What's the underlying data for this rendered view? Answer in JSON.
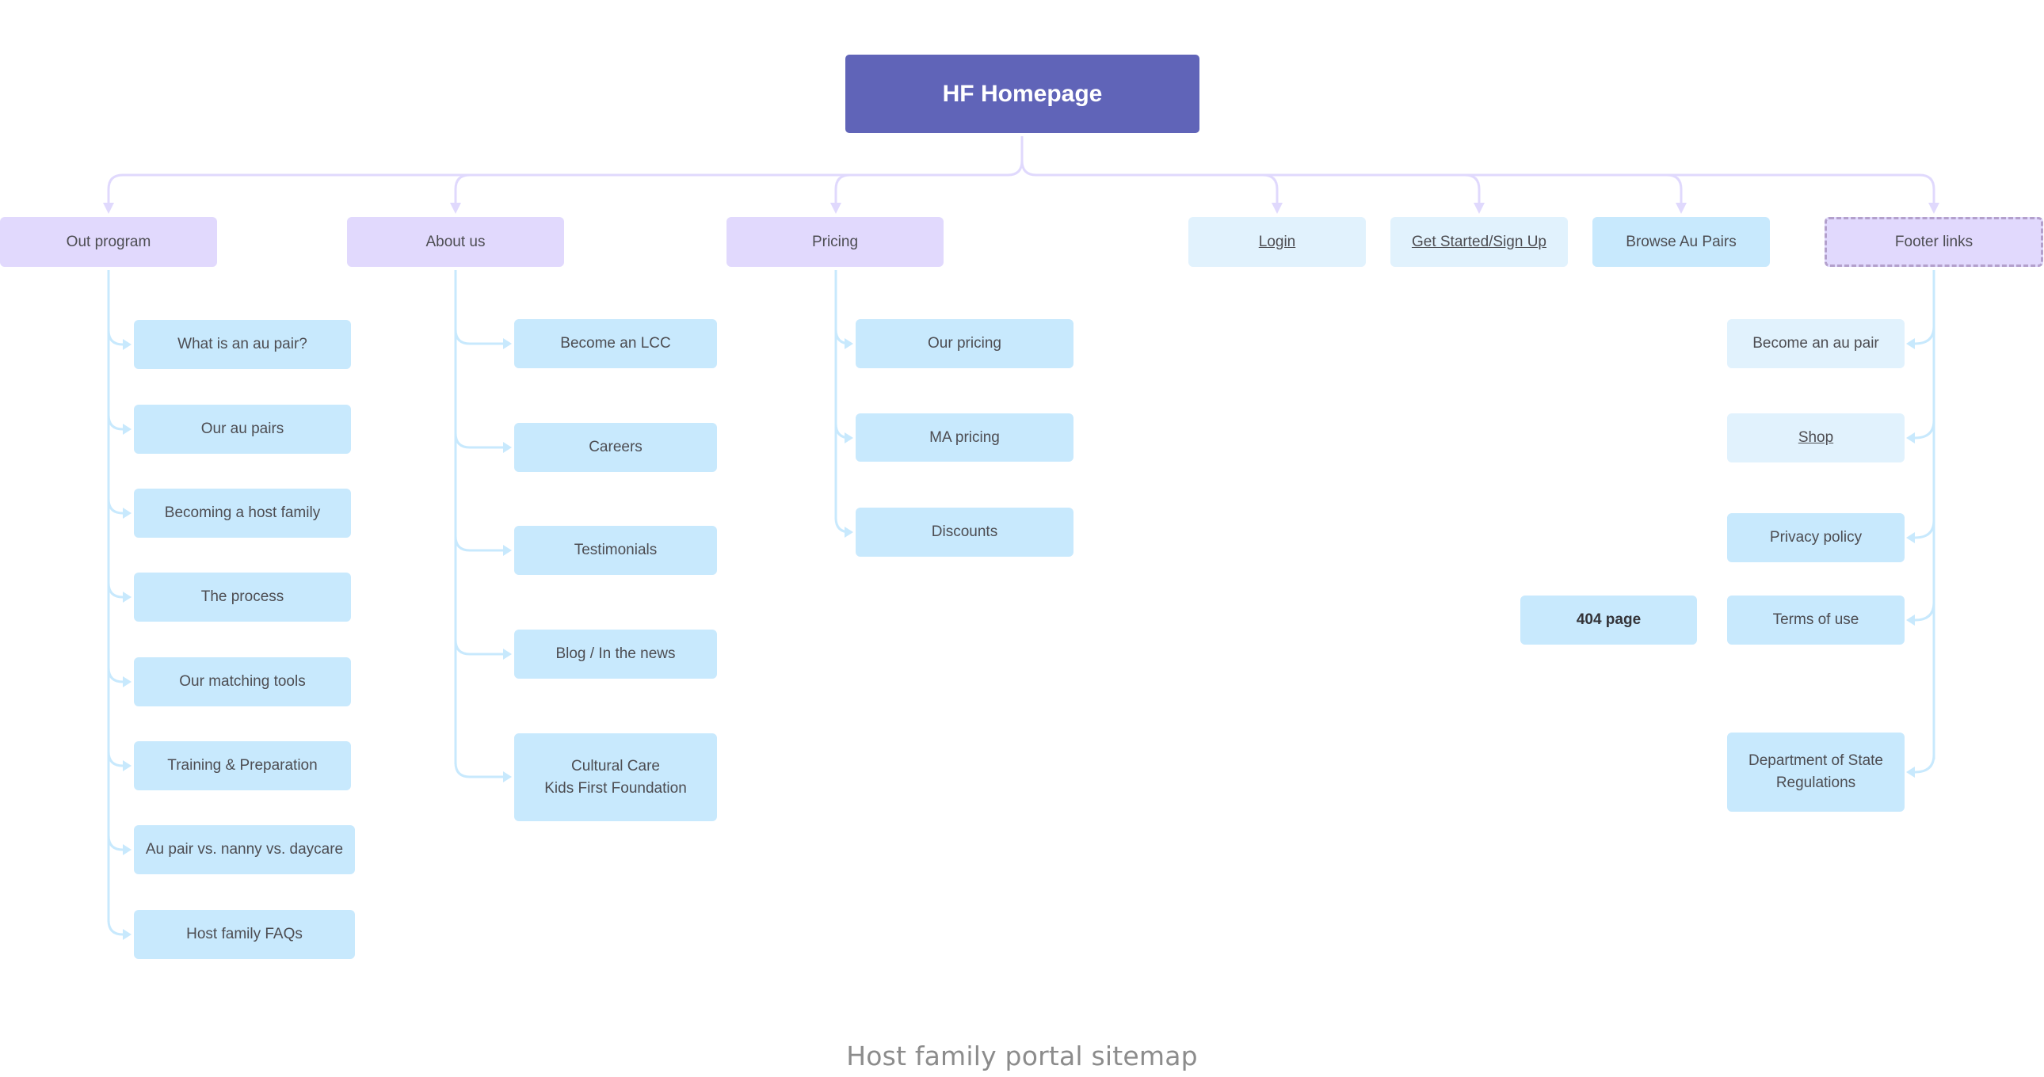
{
  "diagram": {
    "title": "Host family portal sitemap",
    "colors": {
      "root": "#6064b8",
      "section": "#e1d9fd",
      "section_dashed_border": "#b3a0cc",
      "page": "#c8e9fd",
      "page_light": "#e1f2fd",
      "top_connector": "#e0d9fd",
      "child_connector": "#c8e9fd",
      "caption": "#8c8c8c"
    },
    "root": {
      "label": "HF Homepage"
    },
    "sections": [
      {
        "id": "out-program",
        "label": "Out program",
        "style": "section",
        "children": [
          {
            "label": "What is an au pair?",
            "style": "page"
          },
          {
            "label": "Our au pairs",
            "style": "page"
          },
          {
            "label": "Becoming a host family",
            "style": "page"
          },
          {
            "label": "The process",
            "style": "page"
          },
          {
            "label": "Our matching tools",
            "style": "page"
          },
          {
            "label": "Training & Preparation",
            "style": "page"
          },
          {
            "label": "Au pair vs. nanny vs. daycare",
            "style": "page"
          },
          {
            "label": "Host family FAQs",
            "style": "page"
          }
        ]
      },
      {
        "id": "about-us",
        "label": "About us",
        "style": "section",
        "children": [
          {
            "label": "Become an LCC",
            "style": "page"
          },
          {
            "label": "Careers",
            "style": "page"
          },
          {
            "label": "Testimonials",
            "style": "page"
          },
          {
            "label": "Blog / In the news",
            "style": "page"
          },
          {
            "label": "Cultural Care\nKids First Foundation",
            "style": "page"
          }
        ]
      },
      {
        "id": "pricing",
        "label": "Pricing",
        "style": "section",
        "children": [
          {
            "label": "Our pricing",
            "style": "page"
          },
          {
            "label": "MA pricing",
            "style": "page"
          },
          {
            "label": "Discounts",
            "style": "page"
          }
        ]
      },
      {
        "id": "login",
        "label": "Login",
        "style": "page-light",
        "link": true,
        "children": []
      },
      {
        "id": "get-started",
        "label": "Get Started/Sign Up",
        "style": "page-light",
        "link": true,
        "children": []
      },
      {
        "id": "browse-au-pairs",
        "label": "Browse Au Pairs",
        "style": "page",
        "children": []
      },
      {
        "id": "footer-links",
        "label": "Footer links",
        "style": "section-dashed",
        "children": [
          {
            "label": "Become an au pair",
            "style": "page-light"
          },
          {
            "label": "Shop",
            "style": "page-light",
            "link": true
          },
          {
            "label": "Privacy policy",
            "style": "page"
          },
          {
            "label": "Terms of use",
            "style": "page"
          },
          {
            "label": "Department of State\nRegulations",
            "style": "page"
          }
        ]
      }
    ],
    "standalone": [
      {
        "id": "404-page",
        "label": "404 page",
        "style": "page"
      }
    ]
  }
}
